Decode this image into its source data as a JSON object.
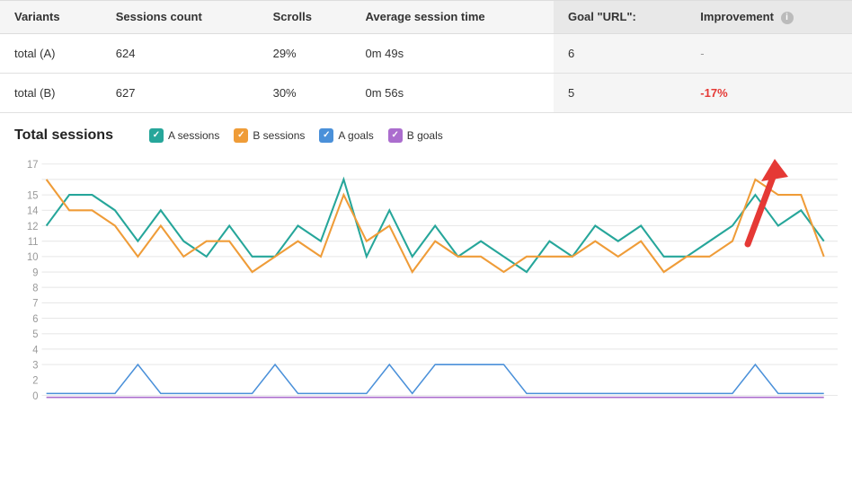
{
  "table": {
    "headers": [
      "Variants",
      "Sessions count",
      "Scrolls",
      "Average session time",
      "Goal \"URL\":",
      "Improvement"
    ],
    "rows": [
      {
        "variant": "total (A)",
        "sessions": "624",
        "scrolls": "29%",
        "avg_session": "0m 49s",
        "goal": "6",
        "improvement": "-",
        "improvement_type": "dash"
      },
      {
        "variant": "total (B)",
        "sessions": "627",
        "scrolls": "30%",
        "avg_session": "0m 56s",
        "goal": "5",
        "improvement": "-17%",
        "improvement_type": "negative"
      }
    ]
  },
  "chart": {
    "title": "Total sessions",
    "legend": [
      {
        "label": "A sessions",
        "color": "#26a69a",
        "type": "check"
      },
      {
        "label": "B sessions",
        "color": "#ef9c38",
        "type": "check"
      },
      {
        "label": "A goals",
        "color": "#4a90d9",
        "type": "check"
      },
      {
        "label": "B goals",
        "color": "#ab6dce",
        "type": "check"
      }
    ],
    "y_labels": [
      "17",
      "15",
      "14",
      "12",
      "11",
      "10",
      "9",
      "8",
      "7",
      "6",
      "5",
      "4",
      "3",
      "2",
      "0"
    ],
    "info_label": "i"
  }
}
